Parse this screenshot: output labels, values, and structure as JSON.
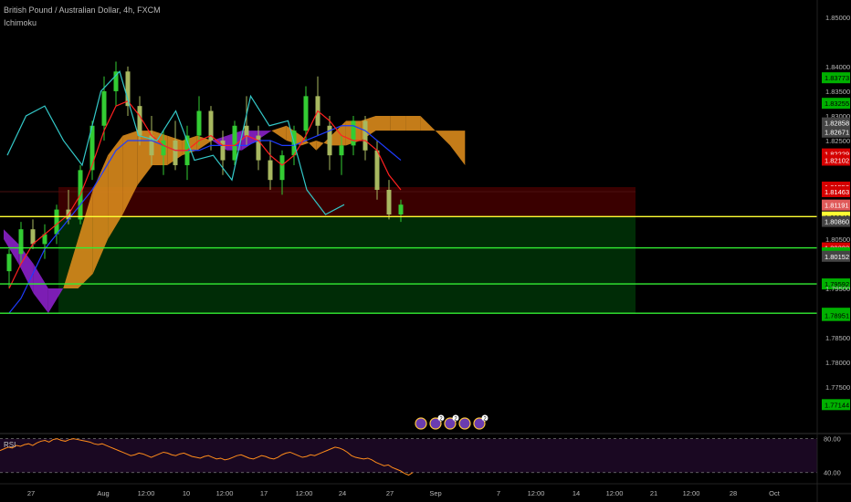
{
  "header": {
    "title": "British Pound / Australian Dollar, 4h, FXCM",
    "indicator": "Ichimoku"
  },
  "colors": {
    "background": "#000000",
    "candle_up": "#33cc33",
    "candle_down": "#a8b860",
    "tenkan": "#ff2020",
    "kijun": "#1e3cff",
    "chikou": "#33c8c8",
    "cloud_bull": "#d98a1c",
    "cloud_bear": "#8a20c8",
    "hline": "#33ee33",
    "hline_main": "#ffff33",
    "stop_zone": "#3a0000",
    "target_zone": "#002c06",
    "rsi_line": "#ff8c1a",
    "rsi_bg": "#1a0822"
  },
  "chart_data": {
    "type": "line",
    "title": "British Pound / Australian Dollar, 4h, FXCM",
    "xlabel": "",
    "ylabel": "",
    "ylim": [
      1.7665,
      1.8535
    ],
    "grid": false,
    "x_ticks": [
      "27",
      "Aug",
      "12:00",
      "10",
      "12:00",
      "17",
      "12:00",
      "24",
      "27",
      "Sep",
      "7",
      "12:00",
      "14",
      "12:00",
      "21",
      "12:00",
      "28",
      "Oct"
    ],
    "y_ticks": [
      "1.85000",
      "1.84000",
      "1.83500",
      "1.83000",
      "1.82500",
      "1.81000",
      "1.80500",
      "1.79500",
      "1.78500",
      "1.78000",
      "1.77500"
    ],
    "price_labels": [
      {
        "text": "1.85000",
        "kind": "tick"
      },
      {
        "text": "1.84000",
        "kind": "tick"
      },
      {
        "text": "1.83773",
        "kind": "green"
      },
      {
        "text": "1.83500",
        "kind": "tick"
      },
      {
        "text": "1.83255",
        "kind": "green"
      },
      {
        "text": "1.83000",
        "kind": "tick"
      },
      {
        "text": "1.82858",
        "kind": "gray"
      },
      {
        "text": "1.82671",
        "kind": "gray"
      },
      {
        "text": "1.82500",
        "kind": "tick"
      },
      {
        "text": "1.82229",
        "kind": "red"
      },
      {
        "text": "1.82102",
        "kind": "red"
      },
      {
        "text": "1.81556",
        "kind": "red"
      },
      {
        "text": "1.81463",
        "kind": "red"
      },
      {
        "text": "1.81191",
        "kind": "salmon"
      },
      {
        "text": "1.81000",
        "kind": "tick"
      },
      {
        "text": "1.80957",
        "kind": "gray"
      },
      {
        "text": "1.80948",
        "kind": "yellow"
      },
      {
        "text": "1.80860",
        "kind": "gray"
      },
      {
        "text": "1.80500",
        "kind": "tick"
      },
      {
        "text": "1.80323",
        "kind": "red"
      },
      {
        "text": "1.80223",
        "kind": "green"
      },
      {
        "text": "1.80152",
        "kind": "gray"
      },
      {
        "text": "1.79592",
        "kind": "green"
      },
      {
        "text": "1.79500",
        "kind": "tick"
      },
      {
        "text": "1.78998",
        "kind": "green"
      },
      {
        "text": "1.78951",
        "kind": "green"
      },
      {
        "text": "1.78500",
        "kind": "tick"
      },
      {
        "text": "1.78000",
        "kind": "tick"
      },
      {
        "text": "1.77500",
        "kind": "tick"
      },
      {
        "text": "1.77144",
        "kind": "green"
      }
    ],
    "horizontal_levels": [
      {
        "value": 1.80957,
        "color": "yellow"
      },
      {
        "value": 1.80323,
        "color": "green"
      },
      {
        "value": 1.79592,
        "color": "green"
      },
      {
        "value": 1.78998,
        "color": "green"
      }
    ],
    "position_box": {
      "x_start": "27",
      "x_end": "21",
      "entry": 1.80957,
      "stop": 1.81556,
      "target": 1.78998
    },
    "candles": [
      {
        "x": 0,
        "o": 1.7985,
        "h": 1.803,
        "l": 1.795,
        "c": 1.802
      },
      {
        "x": 1,
        "o": 1.802,
        "h": 1.8085,
        "l": 1.8,
        "c": 1.807
      },
      {
        "x": 2,
        "o": 1.807,
        "h": 1.809,
        "l": 1.803,
        "c": 1.804
      },
      {
        "x": 3,
        "o": 1.804,
        "h": 1.808,
        "l": 1.801,
        "c": 1.806
      },
      {
        "x": 4,
        "o": 1.806,
        "h": 1.812,
        "l": 1.804,
        "c": 1.811
      },
      {
        "x": 5,
        "o": 1.811,
        "h": 1.815,
        "l": 1.808,
        "c": 1.809
      },
      {
        "x": 6,
        "o": 1.809,
        "h": 1.82,
        "l": 1.808,
        "c": 1.819
      },
      {
        "x": 7,
        "o": 1.819,
        "h": 1.829,
        "l": 1.817,
        "c": 1.828
      },
      {
        "x": 8,
        "o": 1.828,
        "h": 1.838,
        "l": 1.825,
        "c": 1.835
      },
      {
        "x": 9,
        "o": 1.835,
        "h": 1.841,
        "l": 1.832,
        "c": 1.839
      },
      {
        "x": 10,
        "o": 1.839,
        "h": 1.84,
        "l": 1.83,
        "c": 1.832
      },
      {
        "x": 11,
        "o": 1.832,
        "h": 1.834,
        "l": 1.824,
        "c": 1.826
      },
      {
        "x": 12,
        "o": 1.826,
        "h": 1.83,
        "l": 1.82,
        "c": 1.822
      },
      {
        "x": 13,
        "o": 1.822,
        "h": 1.827,
        "l": 1.818,
        "c": 1.825
      },
      {
        "x": 14,
        "o": 1.825,
        "h": 1.829,
        "l": 1.819,
        "c": 1.82
      },
      {
        "x": 15,
        "o": 1.82,
        "h": 1.828,
        "l": 1.817,
        "c": 1.826
      },
      {
        "x": 16,
        "o": 1.826,
        "h": 1.834,
        "l": 1.824,
        "c": 1.831
      },
      {
        "x": 17,
        "o": 1.831,
        "h": 1.832,
        "l": 1.823,
        "c": 1.825
      },
      {
        "x": 18,
        "o": 1.825,
        "h": 1.827,
        "l": 1.818,
        "c": 1.821
      },
      {
        "x": 19,
        "o": 1.821,
        "h": 1.829,
        "l": 1.82,
        "c": 1.828
      },
      {
        "x": 20,
        "o": 1.828,
        "h": 1.834,
        "l": 1.824,
        "c": 1.826
      },
      {
        "x": 21,
        "o": 1.826,
        "h": 1.828,
        "l": 1.819,
        "c": 1.821
      },
      {
        "x": 22,
        "o": 1.821,
        "h": 1.825,
        "l": 1.815,
        "c": 1.817
      },
      {
        "x": 23,
        "o": 1.817,
        "h": 1.823,
        "l": 1.814,
        "c": 1.822
      },
      {
        "x": 24,
        "o": 1.822,
        "h": 1.828,
        "l": 1.82,
        "c": 1.827
      },
      {
        "x": 25,
        "o": 1.827,
        "h": 1.836,
        "l": 1.825,
        "c": 1.834
      },
      {
        "x": 26,
        "o": 1.834,
        "h": 1.838,
        "l": 1.826,
        "c": 1.828
      },
      {
        "x": 27,
        "o": 1.828,
        "h": 1.83,
        "l": 1.819,
        "c": 1.822
      },
      {
        "x": 28,
        "o": 1.822,
        "h": 1.826,
        "l": 1.818,
        "c": 1.824
      },
      {
        "x": 29,
        "o": 1.824,
        "h": 1.83,
        "l": 1.822,
        "c": 1.829
      },
      {
        "x": 30,
        "o": 1.829,
        "h": 1.83,
        "l": 1.821,
        "c": 1.823
      },
      {
        "x": 31,
        "o": 1.823,
        "h": 1.825,
        "l": 1.813,
        "c": 1.815
      },
      {
        "x": 32,
        "o": 1.815,
        "h": 1.817,
        "l": 1.809,
        "c": 1.81
      },
      {
        "x": 33,
        "o": 1.81,
        "h": 1.813,
        "l": 1.8085,
        "c": 1.812
      }
    ],
    "tenkan": [
      1.795,
      1.8,
      1.804,
      1.806,
      1.808,
      1.81,
      1.814,
      1.82,
      1.827,
      1.832,
      1.833,
      1.83,
      1.826,
      1.824,
      1.823,
      1.823,
      1.825,
      1.826,
      1.824,
      1.824,
      1.826,
      1.825,
      1.822,
      1.82,
      1.822,
      1.826,
      1.831,
      1.829,
      1.826,
      1.825,
      1.825,
      1.823,
      1.818,
      1.815
    ],
    "kijun": [
      1.79,
      1.793,
      1.798,
      1.803,
      1.806,
      1.809,
      1.812,
      1.815,
      1.819,
      1.823,
      1.825,
      1.825,
      1.825,
      1.824,
      1.823,
      1.823,
      1.823,
      1.824,
      1.824,
      1.824,
      1.824,
      1.825,
      1.825,
      1.824,
      1.824,
      1.825,
      1.826,
      1.827,
      1.828,
      1.828,
      1.827,
      1.825,
      1.823,
      1.821
    ],
    "chikou": [
      1.822,
      1.83,
      1.832,
      1.825,
      1.82,
      1.835,
      1.839,
      1.826,
      1.825,
      1.831,
      1.821,
      1.822,
      1.817,
      1.834,
      1.828,
      1.829,
      1.815,
      1.81,
      1.812
    ],
    "cloud": {
      "span_a": [
        1.805,
        1.8,
        1.794,
        1.79,
        1.795,
        1.805,
        1.815,
        1.822,
        1.826,
        1.827,
        1.827,
        1.826,
        1.825,
        1.826,
        1.825,
        1.823,
        1.823,
        1.825,
        1.827,
        1.828,
        1.826,
        1.823,
        1.826,
        1.829,
        1.829,
        1.83,
        1.83,
        1.83,
        1.83,
        1.827,
        1.827,
        1.827
      ],
      "span_b": [
        1.807,
        1.804,
        1.8,
        1.795,
        1.795,
        1.795,
        1.798,
        1.805,
        1.81,
        1.816,
        1.82,
        1.82,
        1.822,
        1.823,
        1.825,
        1.826,
        1.827,
        1.827,
        1.827,
        1.825,
        1.824,
        1.825,
        1.824,
        1.824,
        1.825,
        1.827,
        1.827,
        1.827,
        1.827,
        1.827,
        1.824,
        1.82
      ]
    },
    "rsi": {
      "label": "RSI",
      "ylim": [
        30,
        85
      ],
      "y_ticks": [
        "80.00",
        "40.00"
      ],
      "values": [
        66,
        68,
        70,
        69,
        72,
        71,
        73,
        74,
        72,
        75,
        77,
        78,
        76,
        79,
        80,
        78,
        77,
        79,
        80,
        79,
        78,
        77,
        76,
        74,
        73,
        74,
        72,
        70,
        68,
        66,
        64,
        62,
        60,
        61,
        63,
        62,
        60,
        58,
        60,
        62,
        64,
        63,
        61,
        60,
        62,
        63,
        61,
        59,
        58,
        57,
        59,
        60,
        58,
        56,
        57,
        55,
        56,
        58,
        60,
        61,
        59,
        57,
        56,
        58,
        60,
        59,
        57,
        56,
        58,
        61,
        63,
        64,
        62,
        60,
        58,
        59,
        61,
        60,
        62,
        64,
        66,
        68,
        70,
        69,
        67,
        64,
        60,
        58,
        57,
        56,
        57,
        55,
        52,
        50,
        48,
        49,
        46,
        44,
        42,
        39,
        37,
        40
      ]
    }
  },
  "emoji_markers": [
    {
      "label": ""
    },
    {
      "label": "2"
    },
    {
      "label": "2"
    },
    {
      "label": ""
    },
    {
      "label": "2"
    }
  ]
}
